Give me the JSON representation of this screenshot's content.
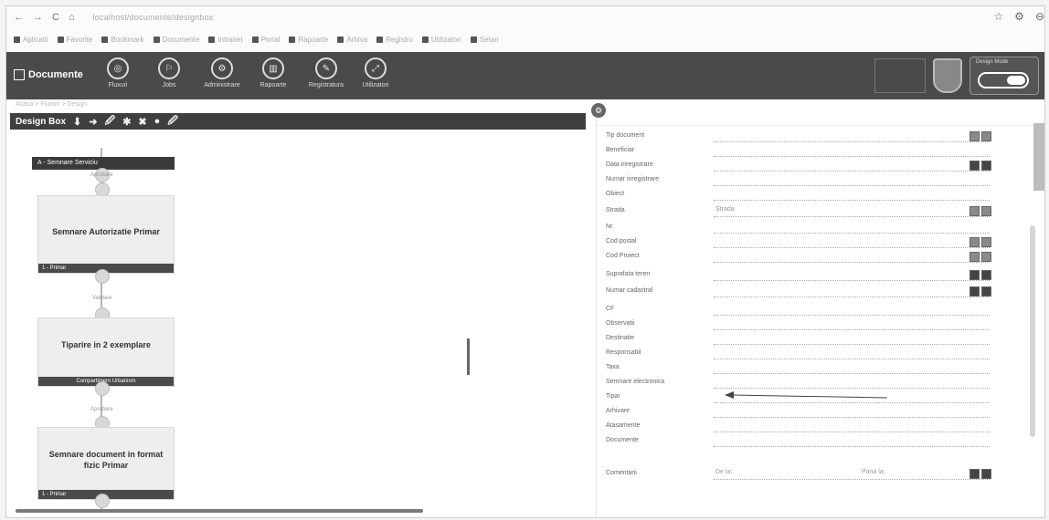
{
  "browser": {
    "back": "←",
    "forward": "→",
    "reload": "C",
    "home": "⌂",
    "url": "localhost/documente/designbox",
    "right_icons": [
      "☆",
      "⚙",
      "⊖"
    ],
    "bookmarks": [
      "Aplicatii",
      "Favorite",
      "Bookmark",
      "Documente",
      "Intranet",
      "Portal",
      "Rapoarte",
      "Arhiva",
      "Registru",
      "Utilizatori",
      "Setari"
    ]
  },
  "app": {
    "brand": "Documente",
    "tools": [
      {
        "label": "Fluxuri",
        "glyph": "◎"
      },
      {
        "label": "Jobs",
        "glyph": "⚐"
      },
      {
        "label": "Administrare",
        "glyph": "⚙"
      },
      {
        "label": "Rapoarte",
        "glyph": "▥"
      },
      {
        "label": "Registratura",
        "glyph": "✎"
      },
      {
        "label": "Utilizatori",
        "glyph": "⤢"
      }
    ],
    "toggle_label": "Design Mode"
  },
  "breadcrumb": "Acasa > Fluxuri > Design",
  "designbox": {
    "title": "Design Box",
    "icons": [
      "⬇",
      "➜",
      "🖉",
      "✱",
      "✖",
      "●",
      "🖉"
    ]
  },
  "flow": {
    "top_node": "A - Semnare Serviciu",
    "connectors": [
      "Aprobare",
      "Validare",
      "Aprobare"
    ],
    "cards": [
      {
        "title": "Semnare Autorizatie Primar",
        "footer": "1 - Primar"
      },
      {
        "title": "Tiparire in 2 exemplare",
        "footer": "Compartiment Urbanism"
      },
      {
        "title": "Semnare document in format fizic Primar",
        "footer": "1 - Primar"
      }
    ]
  },
  "form": {
    "rows": [
      {
        "label": "Tip document",
        "value": ""
      },
      {
        "label": "Beneficiar",
        "value": ""
      },
      {
        "label": "Data inregistrare",
        "value": ""
      },
      {
        "label": "Numar inregistrare",
        "value": ""
      },
      {
        "label": "Obiect",
        "value": ""
      },
      {
        "label": "Strada",
        "value": "Strada"
      },
      {
        "label": "Nr.",
        "value": ""
      },
      {
        "label": "Cod postal",
        "value": ""
      },
      {
        "label": "Cod Proiect",
        "value": ""
      },
      {
        "label": "Suprafata teren",
        "value": ""
      },
      {
        "label": "Numar cadastral",
        "value": ""
      },
      {
        "label": "CF",
        "value": ""
      },
      {
        "label": "Observatii",
        "value": ""
      },
      {
        "label": "Destinatie",
        "value": ""
      },
      {
        "label": "Responsabil",
        "value": ""
      },
      {
        "label": "Taxa",
        "value": ""
      },
      {
        "label": "Semnare electronica",
        "value": ""
      },
      {
        "label": "Tipar",
        "value": ""
      },
      {
        "label": "Arhivare",
        "value": ""
      },
      {
        "label": "Atasamente",
        "value": ""
      },
      {
        "label": "Documente",
        "value": ""
      }
    ],
    "bottom_label": "Comentarii",
    "bottom_fields": [
      "De la:",
      "Pana la:"
    ]
  }
}
